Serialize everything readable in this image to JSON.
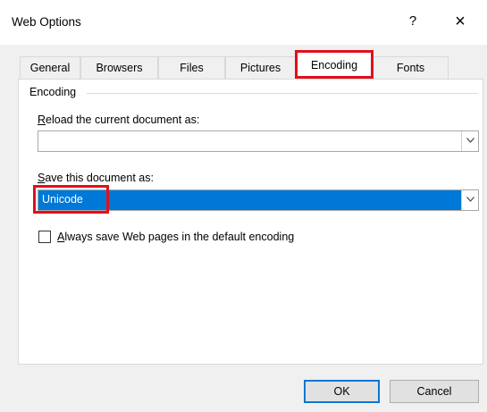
{
  "window": {
    "title": "Web Options",
    "help_label": "?",
    "close_label": "×"
  },
  "tabs": [
    {
      "label": "General"
    },
    {
      "label": "Browsers"
    },
    {
      "label": "Files"
    },
    {
      "label": "Pictures"
    },
    {
      "label": "Encoding",
      "active": true
    },
    {
      "label": "Fonts"
    }
  ],
  "encoding_group": {
    "label": "Encoding",
    "reload_label_accel": "R",
    "reload_label_rest": "eload the current document as:",
    "reload_value": "",
    "save_label_accel": "S",
    "save_label_rest": "ave this document as:",
    "save_value": "Unicode",
    "checkbox_accel": "A",
    "checkbox_label_rest": "lways save Web pages in the default encoding",
    "checkbox_checked": false
  },
  "buttons": {
    "ok": "OK",
    "cancel": "Cancel"
  },
  "colors": {
    "selection": "#0078d7",
    "highlight_box": "#e0101a"
  }
}
